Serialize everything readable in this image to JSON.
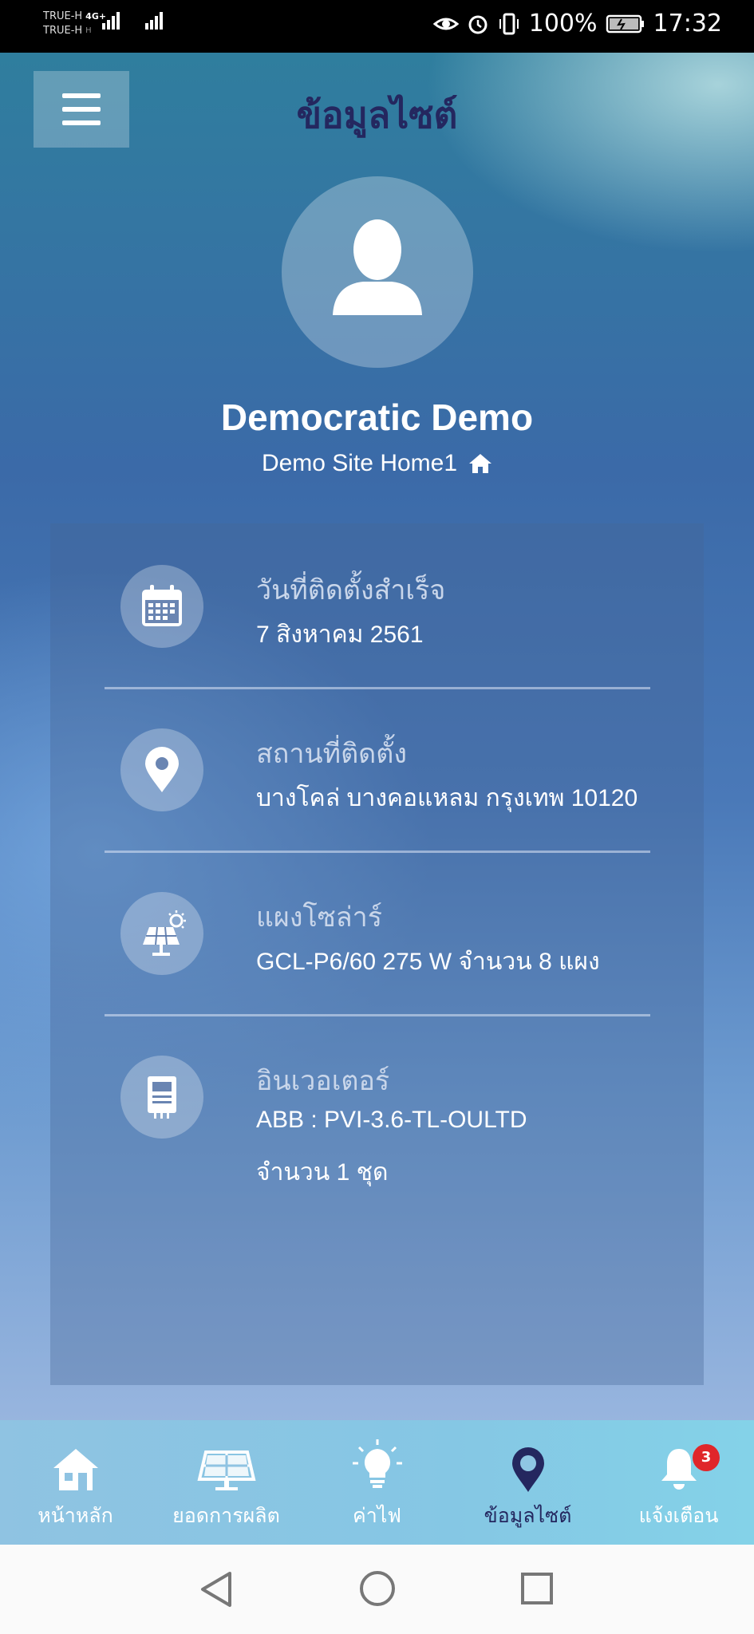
{
  "status_bar": {
    "carrier_1": "TRUE-H",
    "network_1": "4G+",
    "carrier_2": "TRUE-H",
    "network_2": "H",
    "battery": "100%",
    "time": "17:32"
  },
  "header": {
    "title": "ข้อมูลไซต์"
  },
  "profile": {
    "name": "Democratic Demo",
    "site": "Demo Site Home1"
  },
  "info": [
    {
      "label": "วันที่ติดตั้งสำเร็จ",
      "value": "7 สิงหาคม 2561",
      "icon": "calendar-icon"
    },
    {
      "label": "สถานที่ติดตั้ง",
      "value": "บางโคล่ บางคอแหลม กรุงเทพ 10120",
      "icon": "location-pin-icon"
    },
    {
      "label": "แผงโซล่าร์",
      "value": "GCL-P6/60 275 W จำนวน 8 แผง",
      "icon": "solar-panel-icon"
    },
    {
      "label": "อินเวอเตอร์",
      "value": "ABB : PVI-3.6-TL-OULTD",
      "value_2": "จำนวน 1 ชุด",
      "icon": "inverter-icon"
    }
  ],
  "tabs": [
    {
      "label": "หน้าหลัก",
      "icon": "home-icon",
      "active": false
    },
    {
      "label": "ยอดการผลิต",
      "icon": "solar-panel-icon",
      "active": false
    },
    {
      "label": "ค่าไฟ",
      "icon": "light-bulb-icon",
      "active": false
    },
    {
      "label": "ข้อมูลไซต์",
      "icon": "location-pin-icon",
      "active": true
    },
    {
      "label": "แจ้งเตือน",
      "icon": "bell-icon",
      "active": false,
      "badge": "3"
    }
  ],
  "colors": {
    "title_navy": "#24275f",
    "badge_red": "#e0262a",
    "tabbar": "#85c7e4"
  }
}
